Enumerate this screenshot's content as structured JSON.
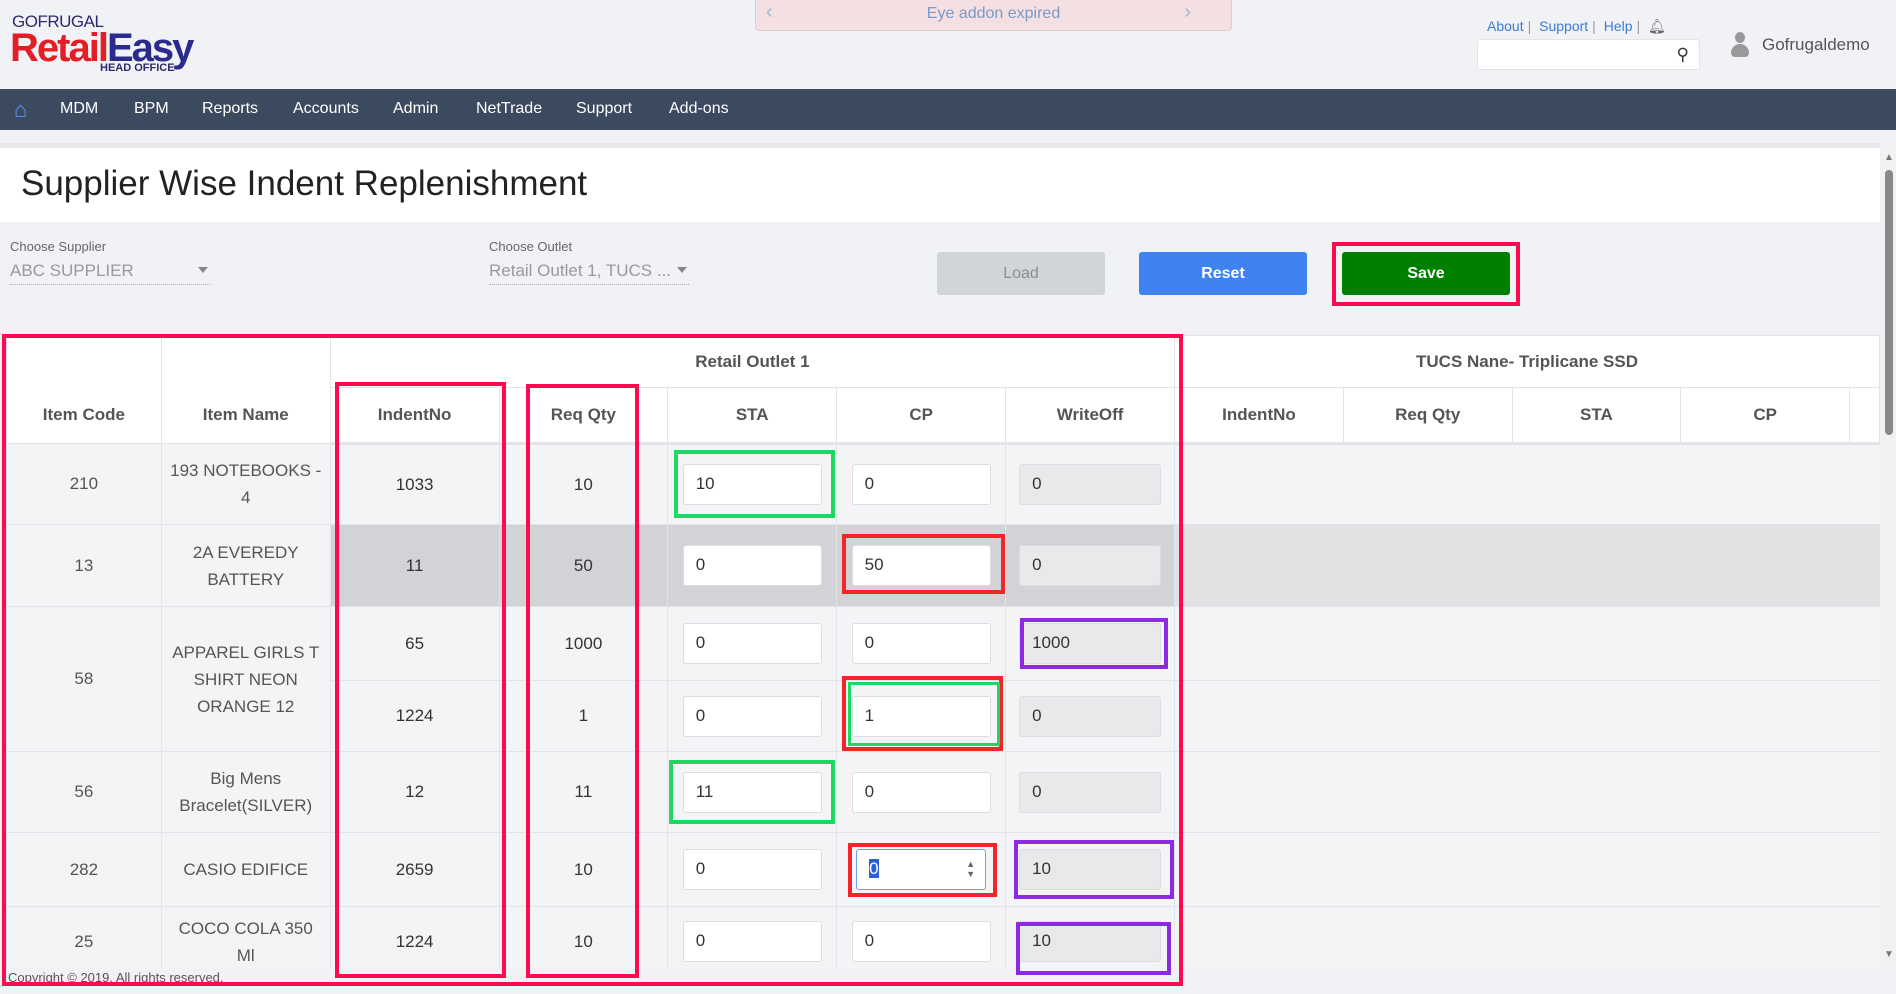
{
  "header": {
    "logo_top": "GOFRUGAL",
    "logo_main_a": "Retail",
    "logo_main_b": "Easy",
    "logo_sub": "HEAD OFFICE",
    "banner": "Eye addon expired",
    "links": [
      "About",
      "Support",
      "Help"
    ],
    "search_placeholder": "",
    "user": "Gofrugaldemo"
  },
  "nav": [
    "MDM",
    "BPM",
    "Reports",
    "Accounts",
    "Admin",
    "NetTrade",
    "Support",
    "Add-ons"
  ],
  "page": {
    "title": "Supplier Wise Indent Replenishment"
  },
  "filters": {
    "supplier_label": "Choose Supplier",
    "supplier_value": "ABC SUPPLIER",
    "outlet_label": "Choose Outlet",
    "outlet_value": "Retail Outlet 1, TUCS ...",
    "load": "Load",
    "reset": "Reset",
    "save": "Save"
  },
  "table": {
    "col_item_code": "Item Code",
    "col_item_name": "Item Name",
    "outlets": [
      {
        "name": "Retail Outlet 1",
        "cols": [
          "IndentNo",
          "Req Qty",
          "STA",
          "CP",
          "WriteOff"
        ]
      },
      {
        "name": "TUCS Nane- Triplicane SSD",
        "cols": [
          "IndentNo",
          "Req Qty",
          "STA",
          "CP"
        ]
      }
    ],
    "rows": [
      {
        "code": "210",
        "name": "193 NOTEBOOKS - 4",
        "indents": [
          {
            "no": "1033",
            "qty": "10",
            "sta": "10",
            "cp": "0",
            "wo": "0"
          }
        ]
      },
      {
        "code": "13",
        "name": "2A EVEREDY BATTERY",
        "highlight": true,
        "indents": [
          {
            "no": "11",
            "qty": "50",
            "sta": "0",
            "cp": "50",
            "wo": "0"
          }
        ]
      },
      {
        "code": "58",
        "name": "APPAREL GIRLS T SHIRT NEON ORANGE 12",
        "indents": [
          {
            "no": "65",
            "qty": "1000",
            "sta": "0",
            "cp": "0",
            "wo": "1000"
          },
          {
            "no": "1224",
            "qty": "1",
            "sta": "0",
            "cp": "1",
            "wo": "0"
          }
        ]
      },
      {
        "code": "56",
        "name": "Big Mens Bracelet(SILVER)",
        "indents": [
          {
            "no": "12",
            "qty": "11",
            "sta": "11",
            "cp": "0",
            "wo": "0"
          }
        ]
      },
      {
        "code": "282",
        "name": "CASIO EDIFICE",
        "indents": [
          {
            "no": "2659",
            "qty": "10",
            "sta": "0",
            "cp": "0",
            "wo": "10",
            "cp_focused": true
          }
        ]
      },
      {
        "code": "25",
        "name": "COCO COLA 350 Ml",
        "indents": [
          {
            "no": "1224",
            "qty": "10",
            "sta": "0",
            "cp": "0",
            "wo": "10"
          }
        ]
      }
    ]
  },
  "footer": "Copyright © 2019. All rights reserved.",
  "colors": {
    "nav_bg": "#3c4a5f",
    "reset": "#3f82f0",
    "save": "#008000",
    "annotation_red": "#ff0a50",
    "annotation_green": "#1ed760",
    "annotation_purple": "#8a2be2"
  }
}
